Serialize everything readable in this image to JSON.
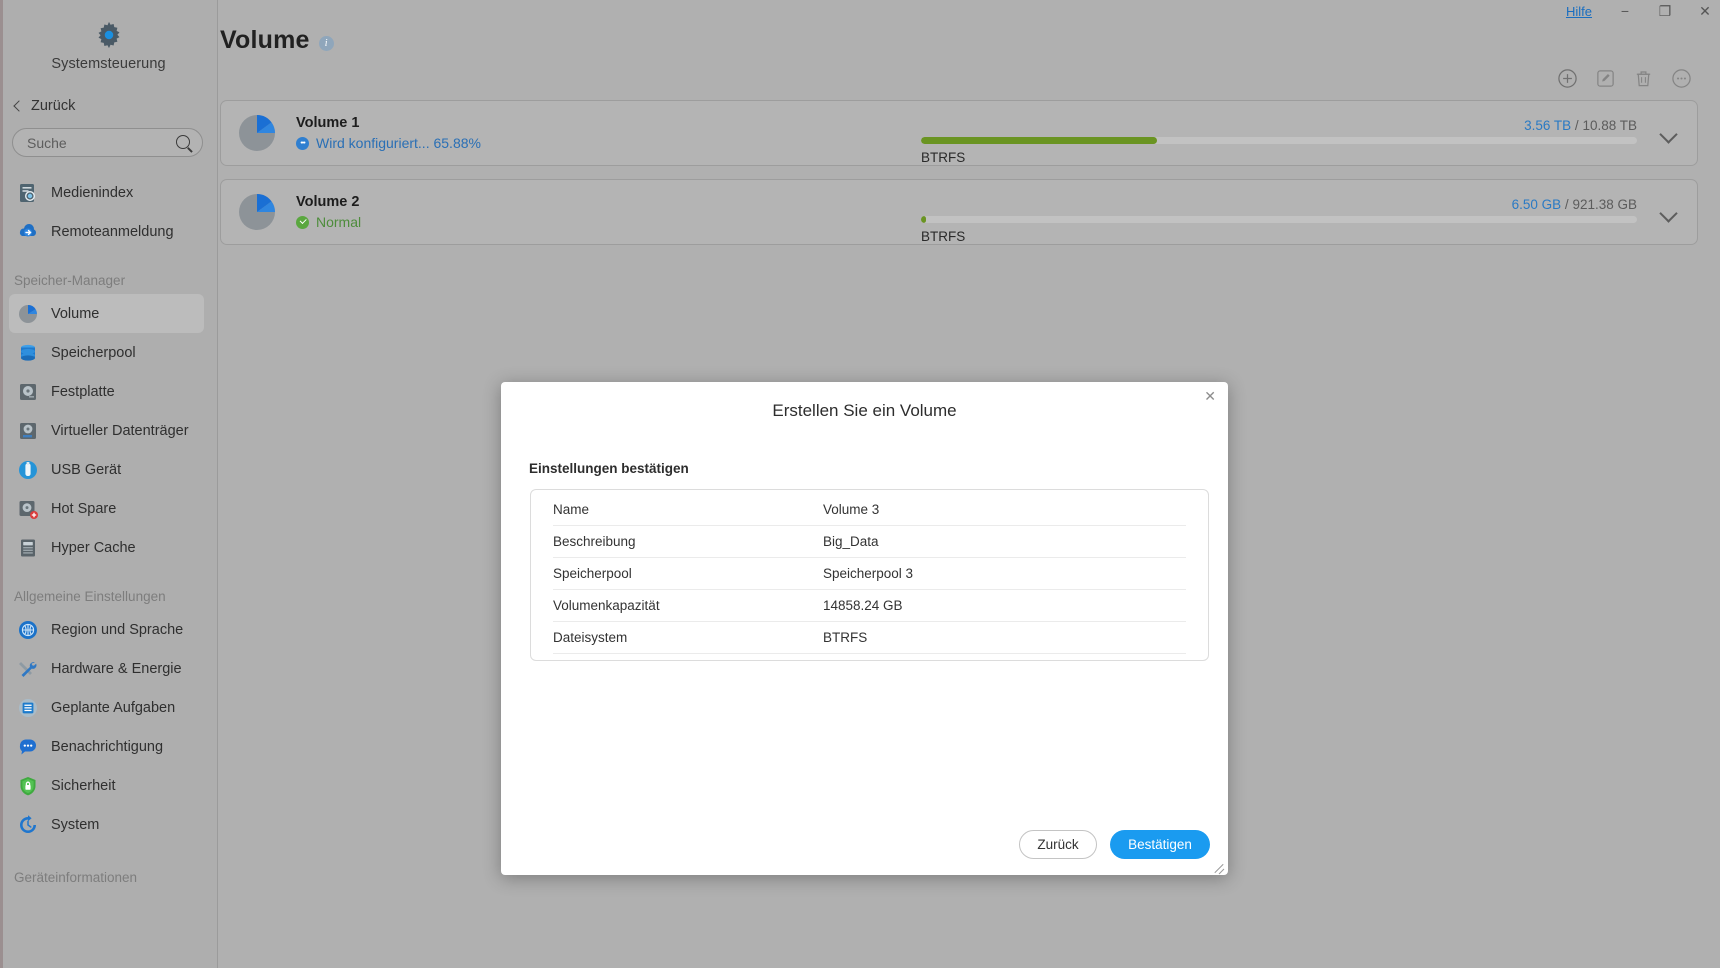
{
  "window": {
    "help_label": "Hilfe",
    "minimize": "−",
    "restore": "❐",
    "close": "✕"
  },
  "sidebar": {
    "app_title": "Systemsteuerung",
    "back_label": "Zurück",
    "search_placeholder": "Suche",
    "search_value": "",
    "top_items": [
      {
        "label": "Medienindex",
        "icon": "media-index-icon"
      },
      {
        "label": "Remoteanmeldung",
        "icon": "remote-login-icon"
      }
    ],
    "groups": [
      {
        "label": "Speicher-Manager",
        "items": [
          {
            "label": "Volume",
            "icon": "volume-pie-icon",
            "active": true
          },
          {
            "label": "Speicherpool",
            "icon": "storage-pool-icon",
            "active": false
          },
          {
            "label": "Festplatte",
            "icon": "hard-disk-icon",
            "active": false
          },
          {
            "label": "Virtueller Datenträger",
            "icon": "virtual-disk-icon",
            "active": false
          },
          {
            "label": "USB Gerät",
            "icon": "usb-device-icon",
            "active": false
          },
          {
            "label": "Hot Spare",
            "icon": "hot-spare-icon",
            "active": false
          },
          {
            "label": "Hyper Cache",
            "icon": "hyper-cache-icon",
            "active": false
          }
        ]
      },
      {
        "label": "Allgemeine Einstellungen",
        "items": [
          {
            "label": "Region und Sprache",
            "icon": "globe-icon",
            "active": false
          },
          {
            "label": "Hardware & Energie",
            "icon": "tools-icon",
            "active": false
          },
          {
            "label": "Geplante Aufgaben",
            "icon": "scheduled-tasks-icon",
            "active": false
          },
          {
            "label": "Benachrichtigung",
            "icon": "notification-icon",
            "active": false
          },
          {
            "label": "Sicherheit",
            "icon": "shield-lock-icon",
            "active": false
          },
          {
            "label": "System",
            "icon": "system-refresh-icon",
            "active": false
          }
        ]
      },
      {
        "label": "Geräteinformationen",
        "items": []
      }
    ]
  },
  "main": {
    "page_title": "Volume",
    "info_glyph": "i",
    "toolbar": [
      {
        "name": "add-volume-button",
        "glyph": "plus-circle",
        "enabled": true
      },
      {
        "name": "edit-volume-button",
        "glyph": "pencil-square",
        "enabled": false
      },
      {
        "name": "delete-volume-button",
        "glyph": "trash",
        "enabled": false
      },
      {
        "name": "more-actions-button",
        "glyph": "ellipsis-circle",
        "enabled": false
      }
    ],
    "volumes": [
      {
        "name": "Volume 1",
        "status_text": "Wird konfiguriert... 65.88%",
        "status_type": "configuring",
        "used": "3.56 TB",
        "separator": "/",
        "total": "10.88 TB",
        "percent": 33,
        "filesystem": "BTRFS"
      },
      {
        "name": "Volume 2",
        "status_text": "Normal",
        "status_type": "normal",
        "used": "6.50 GB",
        "separator": "/",
        "total": "921.38 GB",
        "percent": 0.7,
        "filesystem": "BTRFS"
      }
    ]
  },
  "modal": {
    "title": "Erstellen Sie ein Volume",
    "close_glyph": "✕",
    "subtitle": "Einstellungen bestätigen",
    "rows": [
      {
        "key": "Name",
        "value": "Volume 3"
      },
      {
        "key": "Beschreibung",
        "value": "Big_Data"
      },
      {
        "key": "Speicherpool",
        "value": "Speicherpool 3"
      },
      {
        "key": "Volumenkapazität",
        "value": "14858.24 GB"
      },
      {
        "key": "Dateisystem",
        "value": "BTRFS"
      }
    ],
    "back_label": "Zurück",
    "confirm_label": "Bestätigen"
  },
  "colors": {
    "accent_blue": "#1a9bf0",
    "link_blue": "#1a6ec0",
    "progress_green": "#6a9422",
    "status_green": "#4e8c3c",
    "status_blue": "#2a6fb5"
  }
}
